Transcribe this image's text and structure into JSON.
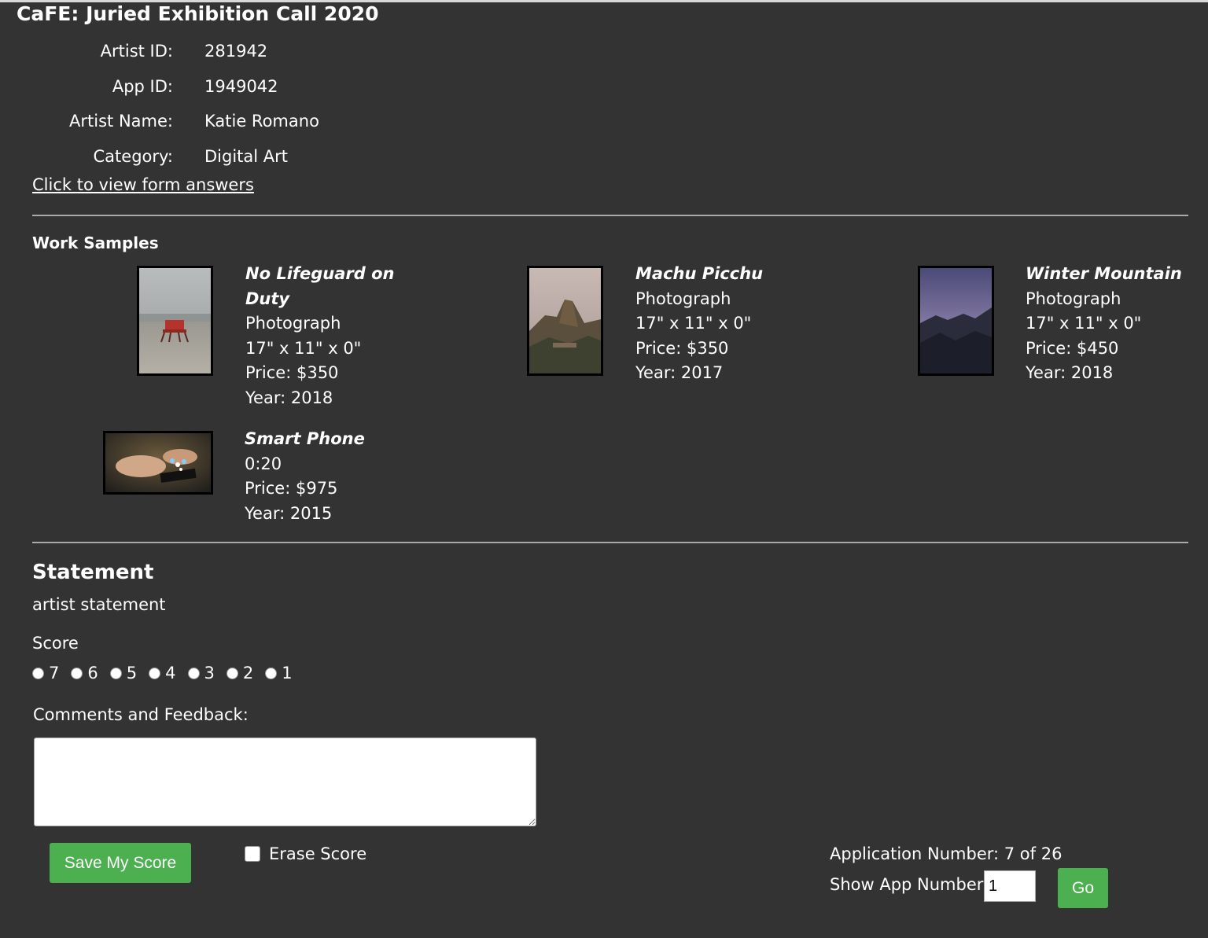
{
  "title": "CaFE: Juried Exhibition Call 2020",
  "info": [
    {
      "label": "Artist ID:",
      "value": "281942"
    },
    {
      "label": "App ID:",
      "value": "1949042"
    },
    {
      "label": "Artist Name:",
      "value": "Katie Romano"
    },
    {
      "label": "Category:",
      "value": "Digital Art"
    }
  ],
  "form_link": "Click to view form answers",
  "work_samples_heading": "Work Samples",
  "works": [
    {
      "title": "No Lifeguard on Duty",
      "medium": "Photograph",
      "size": "17\" x 11\" x 0\"",
      "price": "Price: $350",
      "year": "Year: 2018"
    },
    {
      "title": "Machu Picchu",
      "medium": "Photograph",
      "size": "17\" x 11\" x 0\"",
      "price": "Price: $350",
      "year": "Year: 2017"
    },
    {
      "title": "Winter Mountain",
      "medium": "Photograph",
      "size": "17\" x 11\" x 0\"",
      "price": "Price: $450",
      "year": "Year: 2018"
    },
    {
      "title": "Smart Phone",
      "duration": "0:20",
      "price": "Price: $975",
      "year": "Year: 2015"
    }
  ],
  "statement_heading": "Statement",
  "statement_text": "artist statement",
  "score_label": "Score",
  "score_options": [
    "7",
    "6",
    "5",
    "4",
    "3",
    "2",
    "1"
  ],
  "comments_label": "Comments and Feedback:",
  "comments_value": "",
  "save_button": "Save My Score",
  "erase_label": "Erase Score",
  "app_number": "Application Number: 7 of 26",
  "show_app_label": "Show App Number:",
  "show_app_value": "1",
  "go_button": "Go"
}
